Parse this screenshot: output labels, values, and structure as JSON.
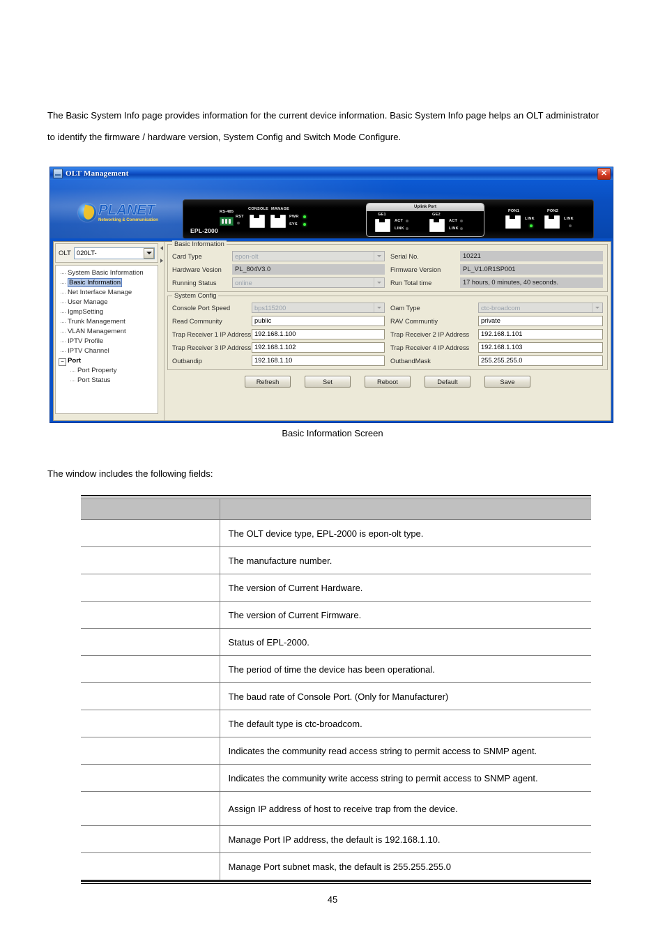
{
  "intro": {
    "paragraph": "The Basic System Info page provides information for the current device information. Basic System Info page helps an OLT administrator to identify the firmware / hardware version, System Config and Switch Mode Configure."
  },
  "window": {
    "title": "OLT Management",
    "close_label": "✕"
  },
  "banner": {
    "logo_word": "PLANET",
    "logo_tagline": "Networking & Communication",
    "device_model": "EPL-2000",
    "panel_labels": {
      "rs485": "RS-485",
      "rst": "RST",
      "console": "CONSOLE",
      "manage": "MANAGE",
      "pwr": "PWR",
      "sys": "SYS",
      "uplink_port": "Uplink Port",
      "ge1": "GE1",
      "ge2": "GE2",
      "act": "ACT",
      "link": "LINK",
      "pon1": "PON1",
      "pon2": "PON2"
    }
  },
  "sidebar": {
    "olt_label": "OLT",
    "olt_value": "020LT-",
    "tree": [
      {
        "label": "System Basic Information",
        "type": "leaf",
        "selected": false
      },
      {
        "label": "Basic Information",
        "type": "leaf",
        "selected": true
      },
      {
        "label": "Net Interface Manage",
        "type": "leaf",
        "selected": false
      },
      {
        "label": "User Manage",
        "type": "leaf",
        "selected": false
      },
      {
        "label": "IgmpSetting",
        "type": "leaf",
        "selected": false
      },
      {
        "label": "Trunk Management",
        "type": "leaf",
        "selected": false
      },
      {
        "label": "VLAN Management",
        "type": "leaf",
        "selected": false
      },
      {
        "label": "IPTV Profile",
        "type": "leaf",
        "selected": false
      },
      {
        "label": "IPTV Channel",
        "type": "leaf",
        "selected": false
      },
      {
        "label": "Port",
        "type": "group",
        "expander": "−",
        "selected": false
      },
      {
        "label": "Port Property",
        "type": "child",
        "selected": false
      },
      {
        "label": "Port Status",
        "type": "child",
        "selected": false
      }
    ]
  },
  "basic_information": {
    "group_title": "Basic Information",
    "card_type_label": "Card Type",
    "card_type_value": "epon-olt",
    "serial_no_label": "Serial No.",
    "serial_no_value": "10221",
    "hardware_version_label": "Hardware Vesion",
    "hardware_version_value": "PL_804V3.0",
    "firmware_version_label": "Firmware Version",
    "firmware_version_value": "PL_V1.0R1SP001",
    "running_status_label": "Running Status",
    "running_status_value": "online",
    "run_total_time_label": "Run Total time",
    "run_total_time_value": "17 hours, 0 minutes, 40 seconds."
  },
  "system_config": {
    "group_title": "System Config",
    "console_port_speed_label": "Console Port Speed",
    "console_port_speed_value": "bps115200",
    "oam_type_label": "Oam Type",
    "oam_type_value": "ctc-broadcom",
    "read_community_label": "Read Community",
    "read_community_value": "public",
    "rw_community_label": "RAV Communtiy",
    "rw_community_value": "private",
    "trap1_label": "Trap Receiver 1 IP Address",
    "trap1_value": "192.168.1.100",
    "trap2_label": "Trap Receiver 2 IP Address",
    "trap2_value": "192.168.1.101",
    "trap3_label": "Trap Receiver 3 IP Address",
    "trap3_value": "192.168.1.102",
    "trap4_label": "Trap Receiver 4 IP Address",
    "trap4_value": "192.168.1.103",
    "outbandip_label": "Outbandip",
    "outbandip_value": "192.168.1.10",
    "outbandmask_label": "OutbandMask",
    "outbandmask_value": "255.255.255.0"
  },
  "buttons": {
    "refresh": "Refresh",
    "set": "Set",
    "reboot": "Reboot",
    "default": "Default",
    "save": "Save"
  },
  "caption": "Basic Information Screen",
  "fields_intro": "The window includes the following fields:",
  "table": {
    "headers": [
      "",
      ""
    ],
    "rows": [
      {
        "field": "",
        "description": "The OLT device type, EPL-2000 is epon-olt type.",
        "tall": false
      },
      {
        "field": "",
        "description": "The manufacture number.",
        "tall": false
      },
      {
        "field": "",
        "description": "The version of Current Hardware.",
        "tall": false
      },
      {
        "field": "",
        "description": "The version of Current Firmware.",
        "tall": false
      },
      {
        "field": "",
        "description": "Status of EPL-2000.",
        "tall": false
      },
      {
        "field": "",
        "description": "The period of time the device has been operational.",
        "tall": false
      },
      {
        "field": "",
        "description": "The baud rate of Console Port. (Only for Manufacturer)",
        "tall": false
      },
      {
        "field": "",
        "description": "The default type is ctc-broadcom.",
        "tall": false
      },
      {
        "field": "",
        "description": "Indicates the community read access string to permit access to SNMP agent.",
        "tall": false
      },
      {
        "field": "",
        "description": "Indicates the community write access string to permit access to SNMP agent.",
        "tall": false
      },
      {
        "field": "",
        "description": "Assign IP address of host to receive trap from the device.",
        "tall": true
      },
      {
        "field": "",
        "description": "Manage Port IP address, the default is 192.168.1.10.",
        "tall": false
      },
      {
        "field": "",
        "description": "Manage Port subnet mask, the default is 255.255.255.0",
        "tall": false
      }
    ]
  },
  "page_number": "45"
}
